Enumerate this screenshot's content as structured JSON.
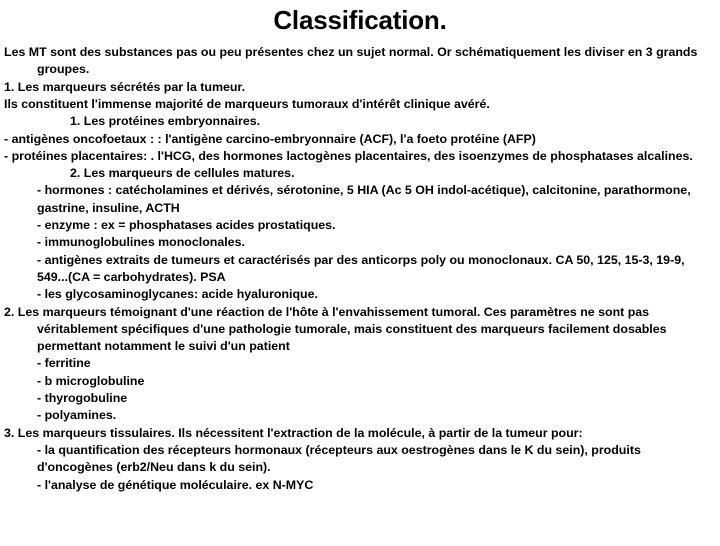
{
  "slide": {
    "title": "Classification.",
    "lines": [
      {
        "id": "intro",
        "text": "Les MT sont des substances pas ou peu présentes chez un sujet normal. Or schématiquement les diviser en 3 grands groupes.",
        "level": 0,
        "hanging": true,
        "name": "paragraph-intro"
      },
      {
        "id": "group-1-heading",
        "text": "1. Les marqueurs sécrétés par la tumeur.",
        "level": 0,
        "hanging": false,
        "name": "heading-group-1"
      },
      {
        "id": "group-1-note",
        "text": "Ils constituent l'immense majorité de marqueurs tumoraux d'intérêt clinique avéré.",
        "level": 0,
        "hanging": false,
        "name": "paragraph-group-1-note"
      },
      {
        "id": "sub-1-1",
        "text": "1. Les protéines embryonnaires.",
        "level": 2,
        "hanging": false,
        "name": "heading-sub-1-1"
      },
      {
        "id": "item-oncofoetaux",
        "text": "- antigènes oncofoetaux : :  l'antigène carcino-embryonnaire (ACF),  l'a foeto protéine (AFP)",
        "level": 0,
        "hanging": false,
        "name": "bullet-antigenes-oncofoetaux"
      },
      {
        "id": "item-placentaires",
        "text": "- protéines placentaires: . l'HCG,  des hormones lactogènes placentaires,  des isoenzymes de phosphatases alcalines.",
        "level": 0,
        "hanging": false,
        "name": "bullet-proteines-placentaires"
      },
      {
        "id": "sub-1-2",
        "text": "2. Les marqueurs de cellules matures.",
        "level": 2,
        "hanging": false,
        "name": "heading-sub-1-2"
      },
      {
        "id": "item-hormones",
        "text": "- hormones : catécholamines et dérivés, sérotonine, 5 HIA (Ac 5 OH indol-acétique), calcitonine, parathormone, gastrine, insuline, ACTH",
        "level": 1,
        "hanging": false,
        "name": "bullet-hormones"
      },
      {
        "id": "item-enzyme",
        "text": "- enzyme : ex = phosphatases acides prostatiques.",
        "level": 1,
        "hanging": false,
        "name": "bullet-enzyme"
      },
      {
        "id": "item-immunoglobulines",
        "text": "- immunoglobulines monoclonales.",
        "level": 1,
        "hanging": false,
        "name": "bullet-immunoglobulines"
      },
      {
        "id": "item-antigenes-extraits",
        "text": "- antigènes extraits de tumeurs et caractérisés par des anticorps poly ou monoclonaux. CA 50, 125, 15-3, 19-9, 549...(CA = carbohydrates). PSA",
        "level": 1,
        "hanging": false,
        "name": "bullet-antigenes-extraits"
      },
      {
        "id": "item-glycosaminoglycanes",
        "text": "- les glycosaminoglycanes: acide hyaluronique.",
        "level": 1,
        "hanging": false,
        "name": "bullet-glycosaminoglycanes"
      },
      {
        "id": "group-2-heading",
        "text": "2. Les marqueurs témoignant d'une réaction de l'hôte à l'envahissement tumoral. Ces paramètres ne sont pas véritablement spécifiques d'une pathologie tumorale, mais constituent des marqueurs facilement dosables permettant notamment le suivi d'un patient",
        "level": 0,
        "hanging": true,
        "name": "heading-group-2"
      },
      {
        "id": "item-ferritine",
        "text": "- ferritine",
        "level": 1,
        "hanging": false,
        "name": "bullet-ferritine"
      },
      {
        "id": "item-b-microglobuline",
        "text": "- b microglobuline",
        "level": 1,
        "hanging": false,
        "name": "bullet-b-microglobuline"
      },
      {
        "id": "item-thyrogobuline",
        "text": "- thyrogobuline",
        "level": 1,
        "hanging": false,
        "name": "bullet-thyrogobuline"
      },
      {
        "id": "item-polyamines",
        "text": "- polyamines.",
        "level": 1,
        "hanging": false,
        "name": "bullet-polyamines"
      },
      {
        "id": "group-3-heading",
        "text": "3. Les marqueurs tissulaires. Ils nécessitent l'extraction de la molécule, à partir de la tumeur pour:",
        "level": 0,
        "hanging": false,
        "name": "heading-group-3"
      },
      {
        "id": "item-quantification",
        "text": "- la quantification des récepteurs hormonaux (récepteurs aux oestrogènes dans le K du sein), produits d'oncogènes (erb2/Neu dans k du sein).",
        "level": 1,
        "hanging": false,
        "name": "bullet-quantification-recepteurs"
      },
      {
        "id": "item-genetique",
        "text": "- l'analyse de génétique moléculaire. ex N-MYC",
        "level": 1,
        "hanging": false,
        "name": "bullet-analyse-genetique"
      }
    ]
  }
}
